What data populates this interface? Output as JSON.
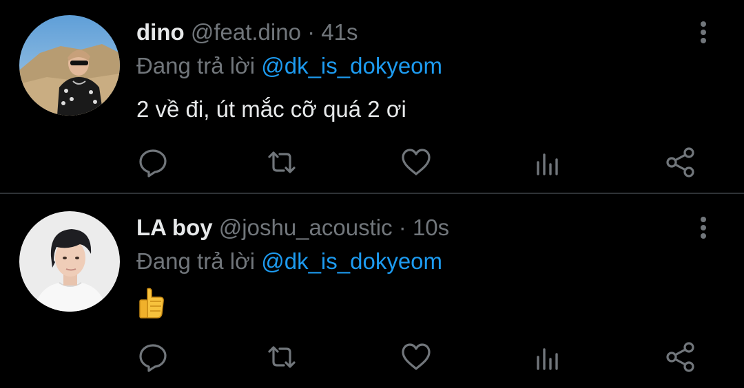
{
  "colors": {
    "background": "#000000",
    "text_primary": "#e7e9ea",
    "text_secondary": "#71767b",
    "accent": "#1d9bf0",
    "divider": "#2f3336"
  },
  "tweets": [
    {
      "display_name": "dino",
      "handle": "@feat.dino",
      "separator": "·",
      "time": "41s",
      "reply_prefix": "Đang trả lời",
      "reply_to": "@dk_is_dokyeom",
      "text": "2 về đi, út mắc cỡ quá 2 ơi",
      "avatar": "profile-photo-icon",
      "actions": [
        "reply-icon",
        "retweet-icon",
        "like-icon",
        "analytics-icon",
        "share-icon"
      ]
    },
    {
      "display_name": "LA boy",
      "handle": "@joshu_acoustic",
      "separator": "·",
      "time": "10s",
      "reply_prefix": "Đang trả lời",
      "reply_to": "@dk_is_dokyeom",
      "text": "👍",
      "avatar": "profile-photo-icon",
      "actions": [
        "reply-icon",
        "retweet-icon",
        "like-icon",
        "analytics-icon",
        "share-icon"
      ]
    }
  ]
}
